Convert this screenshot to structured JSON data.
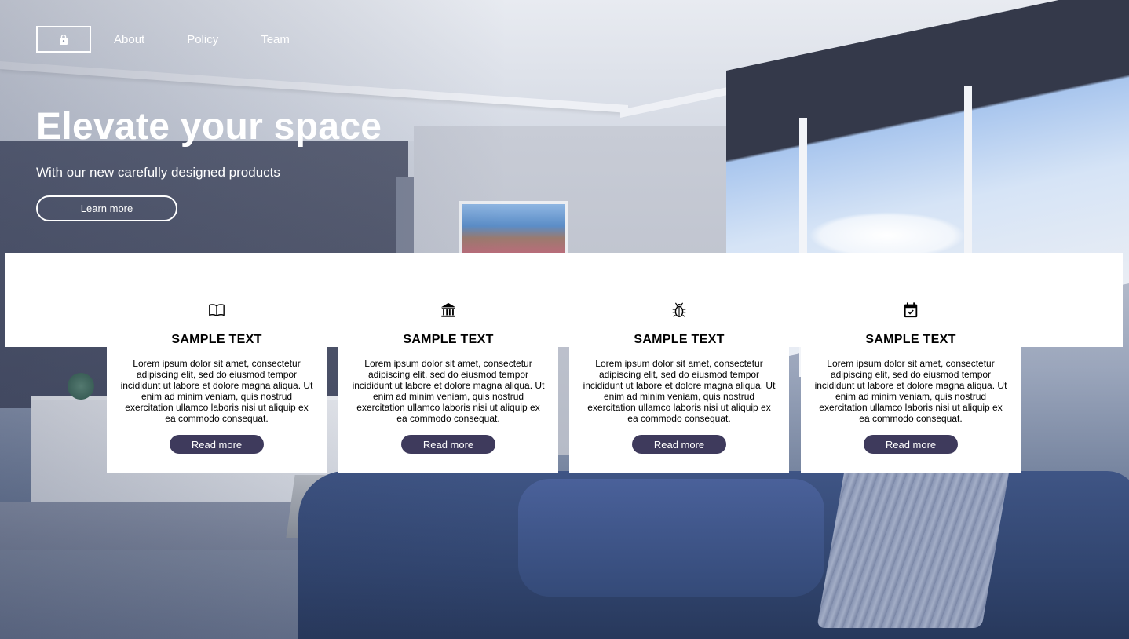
{
  "nav": {
    "logo_icon": "lock-icon",
    "links": [
      {
        "label": "About"
      },
      {
        "label": "Policy"
      },
      {
        "label": "Team"
      }
    ]
  },
  "hero": {
    "title": "Elevate your space",
    "subtitle": "With our new carefully designed products",
    "button_label": "Learn more"
  },
  "features": [
    {
      "icon": "book-icon",
      "title": "SAMPLE TEXT",
      "text": "Lorem ipsum dolor sit amet, consectetur adipiscing elit, sed do eiusmod tempor incididunt ut labore et dolore magna aliqua. Ut enim ad minim veniam, quis nostrud exercitation ullamco laboris nisi ut aliquip ex ea commodo consequat.",
      "button_label": "Read more"
    },
    {
      "icon": "bank-icon",
      "title": "SAMPLE TEXT",
      "text": "Lorem ipsum dolor sit amet, consectetur adipiscing elit, sed do eiusmod tempor incididunt ut labore et dolore magna aliqua. Ut enim ad minim veniam, quis nostrud exercitation ullamco laboris nisi ut aliquip ex ea commodo consequat.",
      "button_label": "Read more"
    },
    {
      "icon": "bug-icon",
      "title": "SAMPLE TEXT",
      "text": "Lorem ipsum dolor sit amet, consectetur adipiscing elit, sed do eiusmod tempor incididunt ut labore et dolore magna aliqua. Ut enim ad minim veniam, quis nostrud exercitation ullamco laboris nisi ut aliquip ex ea commodo consequat.",
      "button_label": "Read more"
    },
    {
      "icon": "calendar-check-icon",
      "title": "SAMPLE TEXT",
      "text": "Lorem ipsum dolor sit amet, consectetur adipiscing elit, sed do eiusmod tempor incididunt ut labore et dolore magna aliqua. Ut enim ad minim veniam, quis nostrud exercitation ullamco laboris nisi ut aliquip ex ea commodo consequat.",
      "button_label": "Read more"
    }
  ],
  "colors": {
    "button_bg": "#3e3a5c",
    "text_light": "#ffffff",
    "text_dark": "#000000"
  }
}
